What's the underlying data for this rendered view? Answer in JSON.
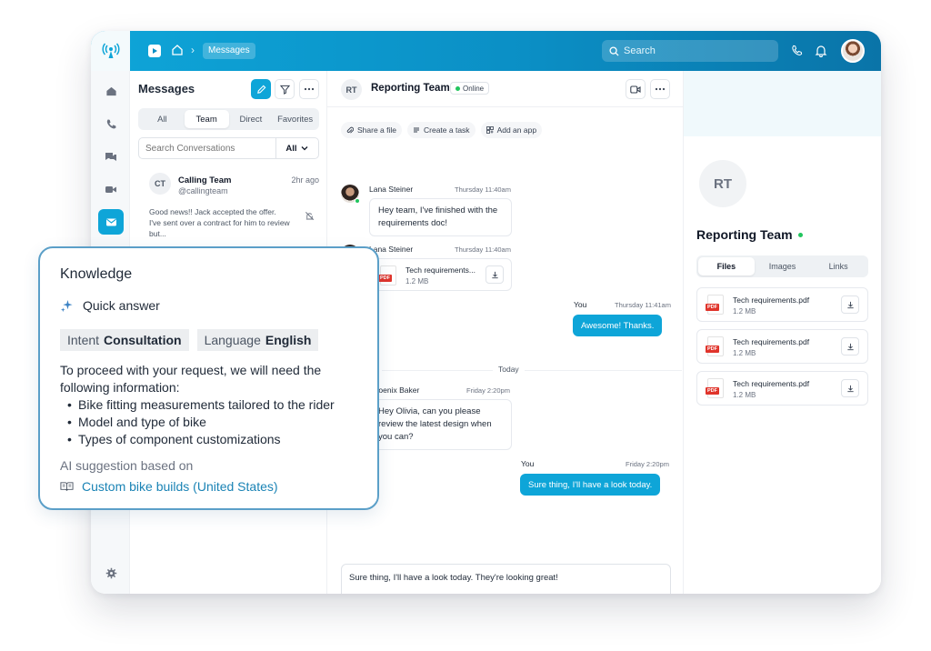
{
  "topbar": {
    "breadcrumb_current": "Messages",
    "search_placeholder": "Search"
  },
  "list": {
    "title": "Messages",
    "tabs": [
      "All",
      "Team",
      "Direct",
      "Favorites"
    ],
    "active_tab": "Team",
    "search_placeholder": "Search Conversations",
    "filter_value": "All",
    "conversations": [
      {
        "initials": "CT",
        "name": "Calling Team",
        "handle": "@callingteam",
        "time": "2hr ago",
        "preview": "Good news!! Jack accepted the offer. I've sent over a contract for him to review but..."
      }
    ]
  },
  "chat": {
    "initials": "RT",
    "name": "Reporting Team",
    "status": "Online",
    "actions": [
      "Share a file",
      "Create a task",
      "Add an app"
    ],
    "messages": [
      {
        "sender": "Lana Steiner",
        "time": "Thursday 11:40am",
        "text": "Hey team, I've finished with the requirements doc!"
      },
      {
        "sender": "Lana Steiner",
        "time": "Thursday 11:40am",
        "file_name": "Tech requirements...",
        "file_size": "1.2 MB"
      },
      {
        "sender": "You",
        "time": "Thursday 11:41am",
        "text": "Awesome! Thanks."
      },
      {
        "sender": "Phoenix Baker",
        "time": "Friday 2:20pm",
        "text": "Hey Olivia, can you please review the latest design when you can?"
      },
      {
        "sender": "You",
        "time": "Friday 2:20pm",
        "text": "Sure thing, I'll have a look today."
      }
    ],
    "divider": "Today",
    "draft": "Sure thing, I'll have a look today. They're looking great!"
  },
  "details": {
    "initials": "RT",
    "name": "Reporting Team",
    "tabs": [
      "Files",
      "Images",
      "Links"
    ],
    "active_tab": "Files",
    "files": [
      {
        "name": "Tech requirements.pdf",
        "size": "1.2 MB"
      },
      {
        "name": "Tech requirements.pdf",
        "size": "1.2 MB"
      },
      {
        "name": "Tech requirements.pdf",
        "size": "1.2 MB"
      }
    ]
  },
  "knowledge": {
    "title": "Knowledge",
    "quick_answer": "Quick answer",
    "intent_label": "Intent",
    "intent_value": "Consultation",
    "language_label": "Language",
    "language_value": "English",
    "intro": "To proceed with your request, we will need the following information:",
    "items": [
      "Bike fitting measurements tailored to the rider",
      "Model and type of bike",
      "Types of component customizations"
    ],
    "basis": "AI suggestion based on",
    "source": "Custom bike builds (United States)"
  },
  "colors": {
    "accent": "#0ea5d8",
    "online": "#22c55e",
    "pdf": "#e0342b",
    "overlay_border": "#5b9fc8"
  }
}
